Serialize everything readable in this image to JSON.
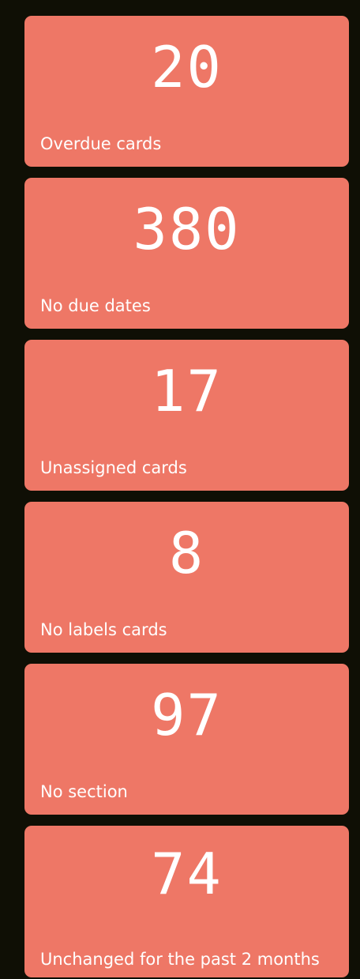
{
  "cards": [
    {
      "value": "20",
      "label": "Overdue cards"
    },
    {
      "value": "380",
      "label": "No due dates"
    },
    {
      "value": "17",
      "label": "Unassigned cards"
    },
    {
      "value": "8",
      "label": "No labels cards"
    },
    {
      "value": "97",
      "label": "No section"
    },
    {
      "value": "74",
      "label": "Unchanged for the past 2 months"
    }
  ],
  "colors": {
    "background": "#0f0f05",
    "card": "#ee7766",
    "text": "#ffffff"
  }
}
